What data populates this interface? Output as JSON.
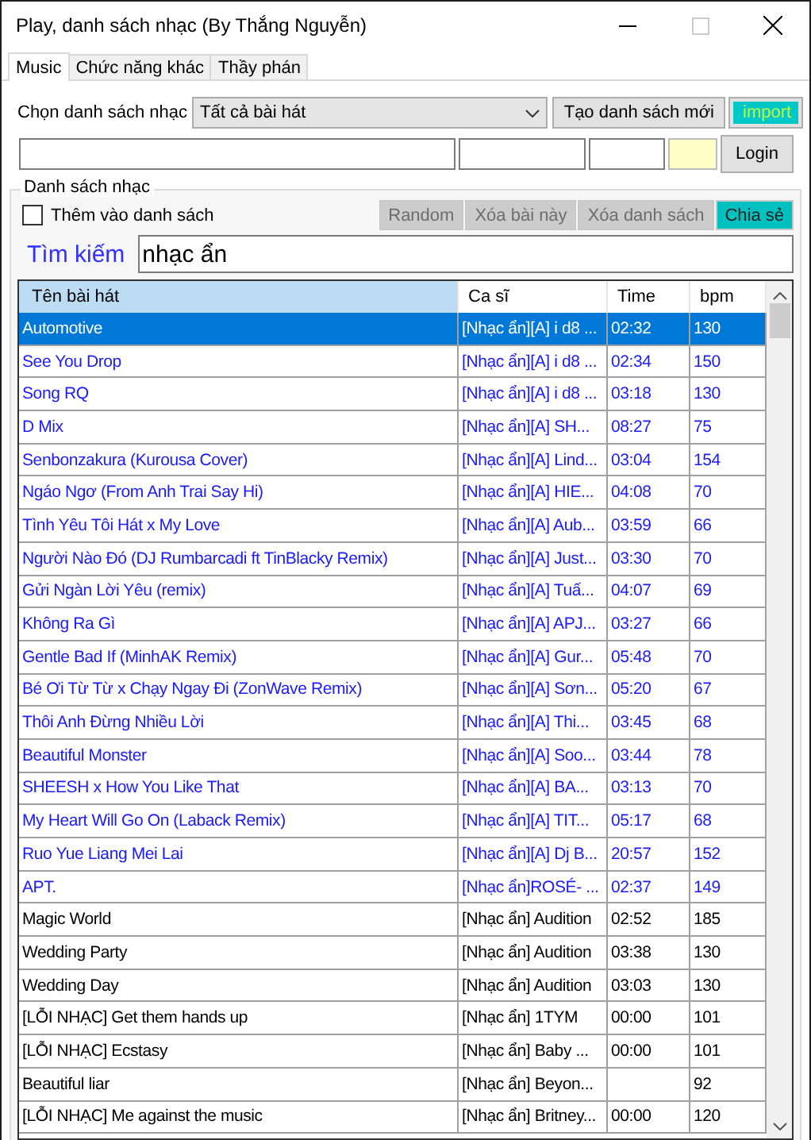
{
  "window": {
    "title": "Play, danh sách nhạc (By Thắng Nguyễn)"
  },
  "tabs": [
    {
      "label": "Music",
      "selected": true
    },
    {
      "label": "Chức năng khác",
      "selected": false
    },
    {
      "label": "Thầy phán",
      "selected": false
    }
  ],
  "playlist_label": "Chọn danh sách nhạc",
  "playlist_dropdown": {
    "value": "Tất cả bài hát"
  },
  "create_button": "Tạo danh sách mới",
  "import_button": "import",
  "login_button": "Login",
  "group": {
    "title": "Danh sách nhạc",
    "add_to_list": {
      "label": "Thêm vào danh sách",
      "checked": false
    },
    "buttons": [
      {
        "label": "Random",
        "kind": "plain"
      },
      {
        "label": "Xóa bài này",
        "kind": "plain"
      },
      {
        "label": "Xóa danh sách",
        "kind": "plain"
      },
      {
        "label": "Chia sẻ",
        "kind": "accent"
      }
    ]
  },
  "search": {
    "label": "Tìm kiếm",
    "value": "nhạc ẩn"
  },
  "table": {
    "columns": [
      "Tên bài hát",
      "Ca sĩ",
      "Time",
      "bpm"
    ],
    "rows": [
      {
        "cells": [
          "Automotive",
          "[Nhạc ẩn][A] i d8 ...",
          "02:32",
          "130"
        ],
        "selected": true,
        "kind": "hidden"
      },
      {
        "cells": [
          "See You Drop",
          "[Nhạc ẩn][A] i d8 ...",
          "02:34",
          "150"
        ],
        "selected": false,
        "kind": "hidden"
      },
      {
        "cells": [
          "Song RQ",
          "[Nhạc ẩn][A] i d8 ...",
          "03:18",
          "130"
        ],
        "selected": false,
        "kind": "hidden"
      },
      {
        "cells": [
          "D Mix",
          "[Nhạc ẩn][A] SH...",
          "08:27",
          "75"
        ],
        "selected": false,
        "kind": "hidden"
      },
      {
        "cells": [
          "Senbonzakura (Kurousa Cover)",
          "[Nhạc ẩn][A] Lind...",
          "03:04",
          "154"
        ],
        "selected": false,
        "kind": "hidden"
      },
      {
        "cells": [
          "Ngáo Ngơ (From Anh Trai Say Hi)",
          "[Nhạc ẩn][A] HIE...",
          "04:08",
          "70"
        ],
        "selected": false,
        "kind": "hidden"
      },
      {
        "cells": [
          "Tình Yêu Tôi Hát x My Love",
          "[Nhạc ẩn][A] Aub...",
          "03:59",
          "66"
        ],
        "selected": false,
        "kind": "hidden"
      },
      {
        "cells": [
          "Người Nào Đó (DJ Rumbarcadi ft TinBlacky Remix)",
          "[Nhạc ẩn][A] Just...",
          "03:30",
          "70"
        ],
        "selected": false,
        "kind": "hidden"
      },
      {
        "cells": [
          "Gửi Ngàn Lời Yêu (remix)",
          "[Nhạc ẩn][A] Tuấ...",
          "04:07",
          "69"
        ],
        "selected": false,
        "kind": "hidden"
      },
      {
        "cells": [
          "Không Ra Gì",
          "[Nhạc ẩn][A] APJ...",
          "03:27",
          "66"
        ],
        "selected": false,
        "kind": "hidden"
      },
      {
        "cells": [
          "Gentle Bad If (MinhAK Remix)",
          "[Nhạc ẩn][A] Gur...",
          "05:48",
          "70"
        ],
        "selected": false,
        "kind": "hidden"
      },
      {
        "cells": [
          "Bé Ơi Từ Từ x Chạy Ngay Đi (ZonWave Remix)",
          "[Nhạc ẩn][A] Sơn...",
          "05:20",
          "67"
        ],
        "selected": false,
        "kind": "hidden"
      },
      {
        "cells": [
          "Thôi Anh Đừng Nhiều Lời",
          "[Nhạc ẩn][A] Thi...",
          "03:45",
          "68"
        ],
        "selected": false,
        "kind": "hidden"
      },
      {
        "cells": [
          "Beautiful Monster",
          "[Nhạc ẩn][A] Soo...",
          "03:44",
          "78"
        ],
        "selected": false,
        "kind": "hidden"
      },
      {
        "cells": [
          "SHEESH x How You Like That",
          "[Nhạc ẩn][A] BA...",
          "03:13",
          "70"
        ],
        "selected": false,
        "kind": "hidden"
      },
      {
        "cells": [
          "My Heart Will Go On (Laback Remix)",
          "[Nhạc ẩn][A] TIT...",
          "05:17",
          "68"
        ],
        "selected": false,
        "kind": "hidden"
      },
      {
        "cells": [
          "Ruo Yue Liang Mei Lai",
          "[Nhạc ẩn][A] Dj B...",
          "20:57",
          "152"
        ],
        "selected": false,
        "kind": "hidden"
      },
      {
        "cells": [
          "APT.",
          "[Nhạc ẩn]ROSÉ- ...",
          "02:37",
          "149"
        ],
        "selected": false,
        "kind": "hidden"
      },
      {
        "cells": [
          "Magic World",
          "[Nhạc ẩn] Audition",
          "02:52",
          "185"
        ],
        "selected": false,
        "kind": "normal"
      },
      {
        "cells": [
          "Wedding Party",
          "[Nhạc ẩn] Audition",
          "03:38",
          "130"
        ],
        "selected": false,
        "kind": "normal"
      },
      {
        "cells": [
          "Wedding Day",
          "[Nhạc ẩn] Audition",
          "03:03",
          "130"
        ],
        "selected": false,
        "kind": "normal"
      },
      {
        "cells": [
          "[LỖI NHẠC] Get them hands up",
          "[Nhạc ẩn] 1TYM",
          "00:00",
          "101"
        ],
        "selected": false,
        "kind": "normal"
      },
      {
        "cells": [
          "[LỖI NHẠC] Ecstasy",
          "[Nhạc ẩn] Baby ...",
          "00:00",
          "101"
        ],
        "selected": false,
        "kind": "normal"
      },
      {
        "cells": [
          "Beautiful liar",
          "[Nhạc ẩn] Beyon...",
          "",
          "92"
        ],
        "selected": false,
        "kind": "normal"
      },
      {
        "cells": [
          "[LỖI NHẠC] Me against the music",
          "[Nhạc ẩn] Britney...",
          "00:00",
          "120"
        ],
        "selected": false,
        "kind": "normal"
      }
    ]
  }
}
